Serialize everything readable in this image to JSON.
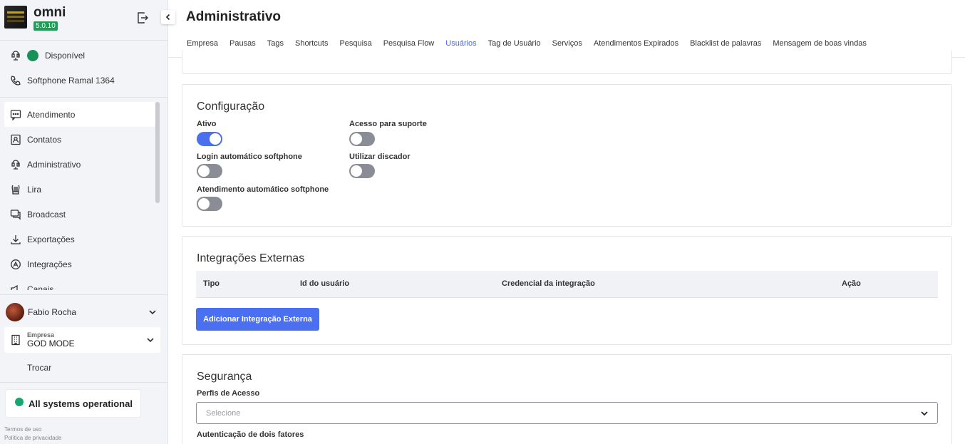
{
  "app": {
    "name": "omni",
    "version": "5.0.10"
  },
  "status": {
    "availability": "Disponível",
    "softphone": "Softphone Ramal 1364"
  },
  "nav": {
    "items": [
      {
        "label": "Atendimento",
        "icon": "chat-icon",
        "active": true
      },
      {
        "label": "Contatos",
        "icon": "contacts-icon"
      },
      {
        "label": "Administrativo",
        "icon": "admin-icon"
      },
      {
        "label": "Lira",
        "icon": "lyre-icon"
      },
      {
        "label": "Broadcast",
        "icon": "broadcast-icon"
      },
      {
        "label": "Exportações",
        "icon": "download-icon"
      },
      {
        "label": "Integrações",
        "icon": "integrations-icon"
      },
      {
        "label": "Canais",
        "icon": "channels-icon"
      }
    ]
  },
  "user": {
    "name": "Fabio Rocha"
  },
  "empresa": {
    "label": "Empresa",
    "value": "GOD MODE",
    "switch": "Trocar"
  },
  "system_status": "All systems operational",
  "footer": {
    "terms": "Termos de uso",
    "privacy": "Política de privacidade"
  },
  "page": {
    "title": "Administrativo"
  },
  "tabs": [
    "Empresa",
    "Pausas",
    "Tags",
    "Shortcuts",
    "Pesquisa",
    "Pesquisa Flow",
    "Usuários",
    "Tag de Usuário",
    "Serviços",
    "Atendimentos Expirados",
    "Blacklist de palavras",
    "Mensagem de boas vindas"
  ],
  "active_tab": "Usuários",
  "configuracao": {
    "title": "Configuração",
    "fields": {
      "ativo": {
        "label": "Ativo",
        "on": true
      },
      "acesso_suporte": {
        "label": "Acesso para suporte",
        "on": false
      },
      "login_auto": {
        "label": "Login automático softphone",
        "on": false
      },
      "discador": {
        "label": "Utilizar discador",
        "on": false
      },
      "atendimento_auto": {
        "label": "Atendimento automático softphone",
        "on": false
      }
    }
  },
  "integracoes": {
    "title": "Integrações Externas",
    "columns": [
      "Tipo",
      "Id do usuário",
      "Credencial da integração",
      "Ação"
    ],
    "add_button": "Adicionar Integração Externa"
  },
  "seguranca": {
    "title": "Segurança",
    "perfis_label": "Perfis de Acesso",
    "perfis_placeholder": "Selecione",
    "next_label": "Autenticação de dois fatores"
  },
  "colors": {
    "accent": "#4a6ff1",
    "green": "#17935a",
    "toggle_off": "#8a8d96"
  }
}
